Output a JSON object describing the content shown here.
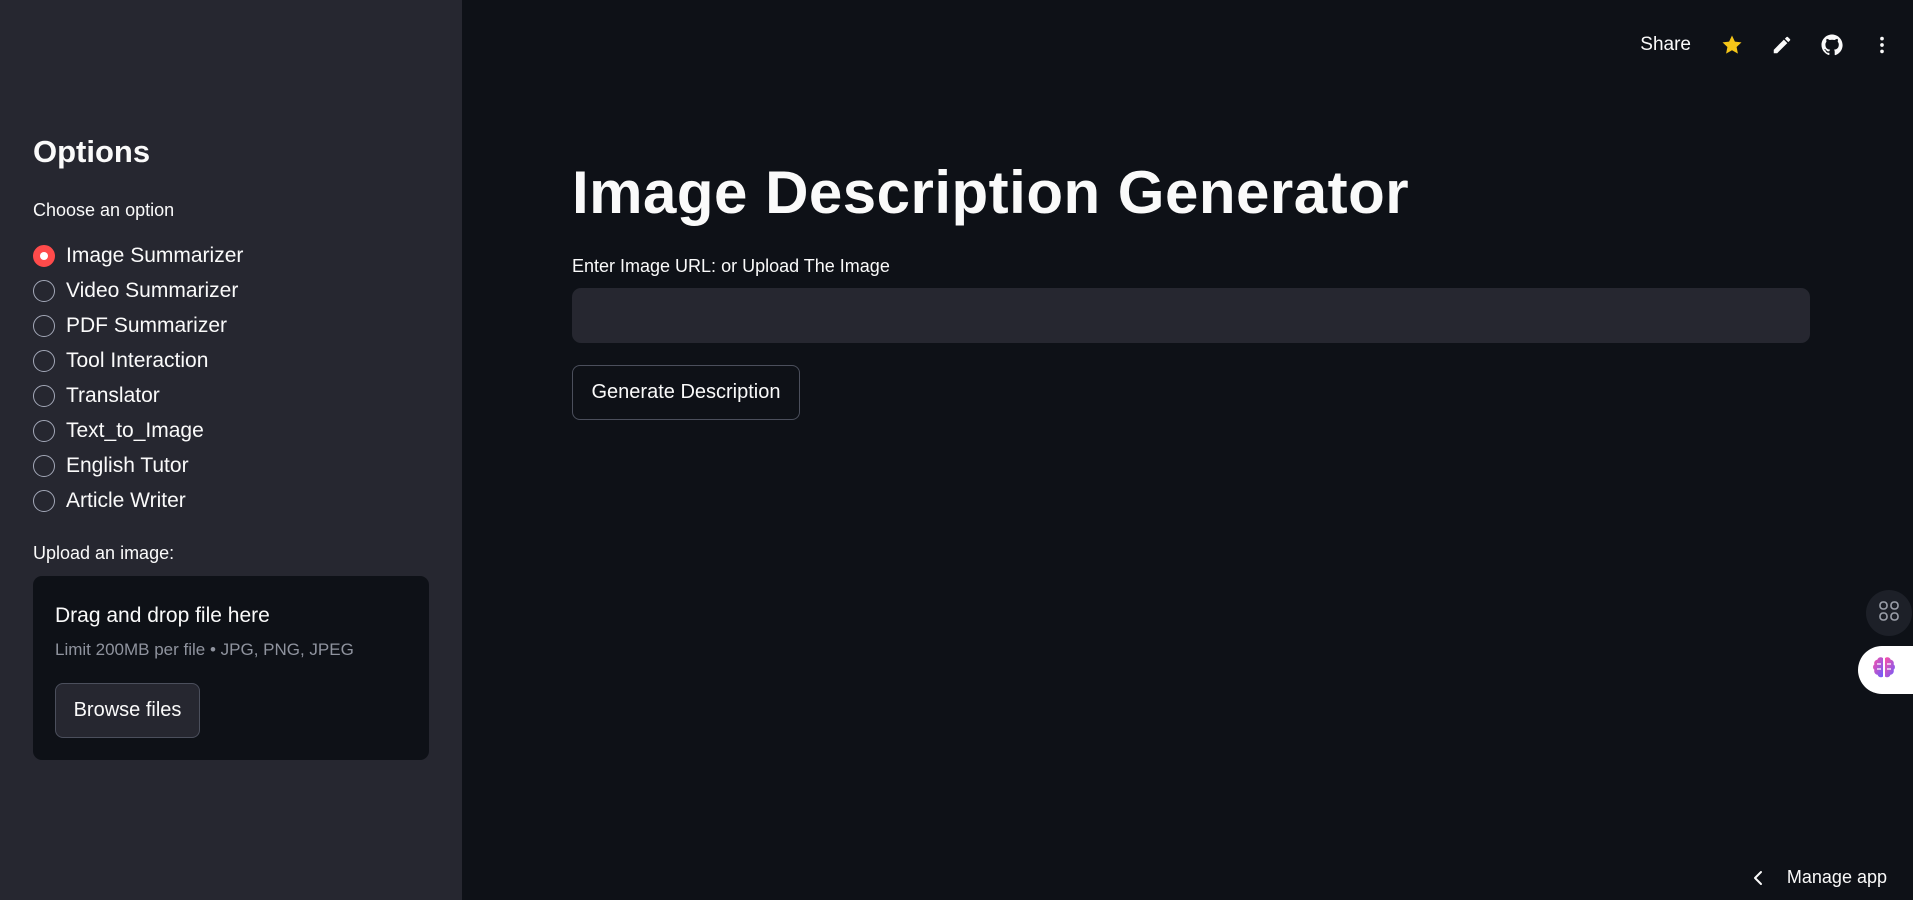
{
  "sidebar": {
    "title": "Options",
    "choose_label": "Choose an option",
    "options": [
      {
        "label": "Image Summarizer",
        "selected": true
      },
      {
        "label": "Video Summarizer",
        "selected": false
      },
      {
        "label": "PDF Summarizer",
        "selected": false
      },
      {
        "label": "Tool Interaction",
        "selected": false
      },
      {
        "label": "Translator",
        "selected": false
      },
      {
        "label": "Text_to_Image",
        "selected": false
      },
      {
        "label": "English Tutor",
        "selected": false
      },
      {
        "label": "Article Writer",
        "selected": false
      }
    ],
    "upload_label": "Upload an image:",
    "dropzone": {
      "title": "Drag and drop file here",
      "subtitle": "Limit 200MB per file • JPG, PNG, JPEG",
      "browse_label": "Browse files"
    }
  },
  "header": {
    "share_label": "Share",
    "icons": [
      "star-icon",
      "pencil-icon",
      "github-icon",
      "more-vertical-icon"
    ]
  },
  "main": {
    "title": "Image Description Generator",
    "url_label": "Enter Image URL: or Upload The Image",
    "url_value": "",
    "generate_label": "Generate Description"
  },
  "footer": {
    "manage_label": "Manage app"
  },
  "colors": {
    "accent": "#ff4b4b",
    "background": "#0e1117",
    "sidebar": "#262730",
    "star": "#f5c518"
  }
}
